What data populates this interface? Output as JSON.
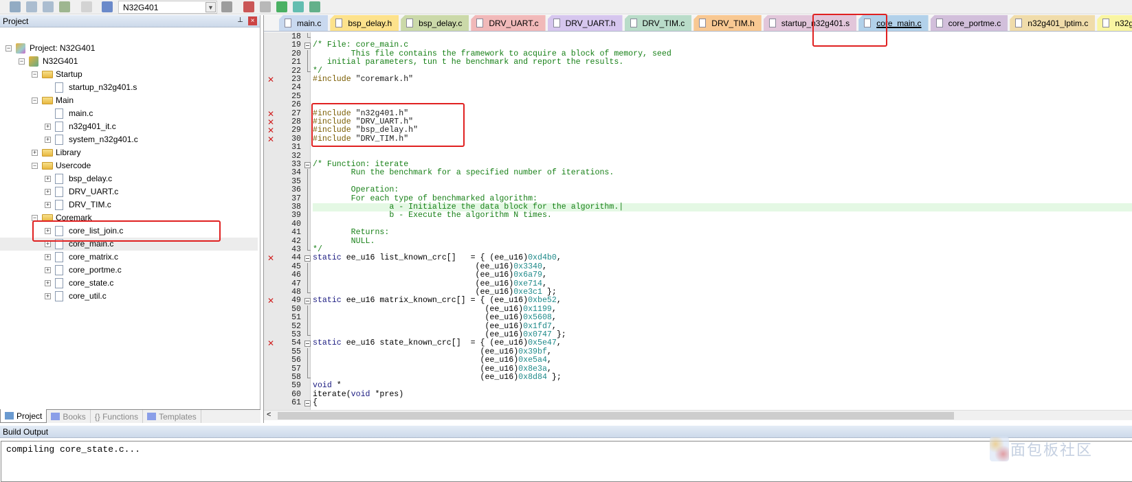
{
  "toolbar": {
    "target": "N32G401",
    "icons": [
      "batch-build-icon",
      "build-icon",
      "rebuild-icon",
      "stack-icon",
      "translate-icon",
      "load-icon",
      "options-icon",
      "manage-components-icon",
      "copy-icon",
      "pack-icon",
      "diamond-icon",
      "books-stack-icon"
    ]
  },
  "project_panel": {
    "title": "Project",
    "pin": "⊥",
    "close": "×"
  },
  "tree": [
    {
      "label": "Project: N32G401",
      "level": 0,
      "expander": "minus",
      "icon": "proj"
    },
    {
      "label": "N32G401",
      "level": 1,
      "expander": "minus",
      "icon": "target"
    },
    {
      "label": "Startup",
      "level": 2,
      "expander": "minus",
      "icon": "folder"
    },
    {
      "label": "startup_n32g401.s",
      "level": 3,
      "expander": "",
      "icon": "file"
    },
    {
      "label": "Main",
      "level": 2,
      "expander": "minus",
      "icon": "folder"
    },
    {
      "label": "main.c",
      "level": 3,
      "expander": "",
      "icon": "file"
    },
    {
      "label": "n32g401_it.c",
      "level": 3,
      "expander": "plus",
      "icon": "file"
    },
    {
      "label": "system_n32g401.c",
      "level": 3,
      "expander": "plus",
      "icon": "file"
    },
    {
      "label": "Library",
      "level": 2,
      "expander": "plus",
      "icon": "folder"
    },
    {
      "label": "Usercode",
      "level": 2,
      "expander": "minus",
      "icon": "folder"
    },
    {
      "label": "bsp_delay.c",
      "level": 3,
      "expander": "plus",
      "icon": "file"
    },
    {
      "label": "DRV_UART.c",
      "level": 3,
      "expander": "plus",
      "icon": "file"
    },
    {
      "label": "DRV_TIM.c",
      "level": 3,
      "expander": "plus",
      "icon": "file"
    },
    {
      "label": "Coremark",
      "level": 2,
      "expander": "minus",
      "icon": "folder"
    },
    {
      "label": "core_list_join.c",
      "level": 3,
      "expander": "plus",
      "icon": "file"
    },
    {
      "label": "core_main.c",
      "level": 3,
      "expander": "plus",
      "icon": "file",
      "selected": true
    },
    {
      "label": "core_matrix.c",
      "level": 3,
      "expander": "plus",
      "icon": "file"
    },
    {
      "label": "core_portme.c",
      "level": 3,
      "expander": "plus",
      "icon": "file"
    },
    {
      "label": "core_state.c",
      "level": 3,
      "expander": "plus",
      "icon": "file"
    },
    {
      "label": "core_util.c",
      "level": 3,
      "expander": "plus",
      "icon": "file"
    }
  ],
  "panel_tabs": [
    {
      "label": "Project",
      "active": true,
      "icon": "project-window-icon"
    },
    {
      "label": "Books",
      "icon": "books-icon"
    },
    {
      "label": "{} Functions",
      "icon": ""
    },
    {
      "label": "Templates",
      "icon": "templates-icon"
    }
  ],
  "editor_tabs": [
    {
      "label": "main.c",
      "color": "#c9d9ef"
    },
    {
      "label": "bsp_delay.h",
      "color": "#fde28c"
    },
    {
      "label": "bsp_delay.c",
      "color": "#cbd9a9"
    },
    {
      "label": "DRV_UART.c",
      "color": "#f1b9b9"
    },
    {
      "label": "DRV_UART.h",
      "color": "#d6c6ee"
    },
    {
      "label": "DRV_TIM.c",
      "color": "#b9dcc9"
    },
    {
      "label": "DRV_TIM.h",
      "color": "#f8c892"
    },
    {
      "label": "startup_n32g401.s",
      "color": "#e2c6da"
    },
    {
      "label": "core_main.c",
      "color": "#b2d1ea",
      "active": true
    },
    {
      "label": "core_portme.c",
      "color": "#d2bfdb"
    },
    {
      "label": "n32g401_lptim.c",
      "color": "#f0dcaa"
    },
    {
      "label": "n32g",
      "color": "#f9f5a2"
    }
  ],
  "code_lines": [
    {
      "n": "18",
      "fold": "end",
      "parts": []
    },
    {
      "n": "19",
      "fold": "open",
      "parts": [
        {
          "c": "cm",
          "t": "/* File: core_main.c"
        }
      ]
    },
    {
      "n": "20",
      "fold": "line",
      "parts": [
        {
          "c": "cm",
          "t": "        This file contains the framework to acquire a block of memory, seed"
        }
      ]
    },
    {
      "n": "21",
      "fold": "line",
      "parts": [
        {
          "c": "cm",
          "t": "   initial parameters, tun t he benchmark and report the results."
        }
      ]
    },
    {
      "n": "22",
      "fold": "end",
      "parts": [
        {
          "c": "cm",
          "t": "*/"
        }
      ]
    },
    {
      "n": "23",
      "err": true,
      "parts": [
        {
          "c": "pp",
          "t": "#include "
        },
        {
          "c": "str",
          "t": "\"coremark.h\""
        }
      ]
    },
    {
      "n": "24",
      "parts": []
    },
    {
      "n": "25",
      "parts": []
    },
    {
      "n": "26",
      "parts": []
    },
    {
      "n": "27",
      "err": true,
      "parts": [
        {
          "c": "pp",
          "t": "#include "
        },
        {
          "c": "str",
          "t": "\"n32g401.h\""
        }
      ]
    },
    {
      "n": "28",
      "err": true,
      "parts": [
        {
          "c": "pp",
          "t": "#include "
        },
        {
          "c": "str",
          "t": "\"DRV_UART.h\""
        }
      ]
    },
    {
      "n": "29",
      "err": true,
      "parts": [
        {
          "c": "pp",
          "t": "#include "
        },
        {
          "c": "str",
          "t": "\"bsp_delay.h\""
        }
      ]
    },
    {
      "n": "30",
      "err": true,
      "parts": [
        {
          "c": "pp",
          "t": "#include "
        },
        {
          "c": "str",
          "t": "\"DRV_TIM.h\""
        }
      ]
    },
    {
      "n": "31",
      "parts": []
    },
    {
      "n": "32",
      "parts": []
    },
    {
      "n": "33",
      "fold": "open",
      "parts": [
        {
          "c": "cm",
          "t": "/* Function: iterate"
        }
      ]
    },
    {
      "n": "34",
      "fold": "line",
      "parts": [
        {
          "c": "cm",
          "t": "        Run the benchmark for a specified number of iterations."
        }
      ]
    },
    {
      "n": "35",
      "fold": "line",
      "parts": []
    },
    {
      "n": "36",
      "fold": "line",
      "parts": [
        {
          "c": "cm",
          "t": "        Operation:"
        }
      ]
    },
    {
      "n": "37",
      "fold": "line",
      "parts": [
        {
          "c": "cm",
          "t": "        For each type of benchmarked algorithm:"
        }
      ]
    },
    {
      "n": "38",
      "fold": "line",
      "hl": true,
      "parts": [
        {
          "c": "cm",
          "t": "                a - Initialize the data block for the algorithm.|"
        }
      ]
    },
    {
      "n": "39",
      "fold": "line",
      "parts": [
        {
          "c": "cm",
          "t": "                b - Execute the algorithm N times."
        }
      ]
    },
    {
      "n": "40",
      "fold": "line",
      "parts": []
    },
    {
      "n": "41",
      "fold": "line",
      "parts": [
        {
          "c": "cm",
          "t": "        Returns:"
        }
      ]
    },
    {
      "n": "42",
      "fold": "line",
      "parts": [
        {
          "c": "cm",
          "t": "        NULL."
        }
      ]
    },
    {
      "n": "43",
      "fold": "end",
      "parts": [
        {
          "c": "cm",
          "t": "*/"
        }
      ]
    },
    {
      "n": "44",
      "err": true,
      "fold": "open",
      "parts": [
        {
          "c": "kw",
          "t": "static "
        },
        {
          "c": "pl",
          "t": "ee_u16 list_known_crc[]   = { (ee_u16)"
        },
        {
          "c": "num-lit",
          "t": "0xd4b0"
        },
        {
          "c": "pl",
          "t": ","
        }
      ]
    },
    {
      "n": "45",
      "fold": "line",
      "parts": [
        {
          "c": "pl",
          "t": "                                  (ee_u16)"
        },
        {
          "c": "num-lit",
          "t": "0x3340"
        },
        {
          "c": "pl",
          "t": ","
        }
      ]
    },
    {
      "n": "46",
      "fold": "line",
      "parts": [
        {
          "c": "pl",
          "t": "                                  (ee_u16)"
        },
        {
          "c": "num-lit",
          "t": "0x6a79"
        },
        {
          "c": "pl",
          "t": ","
        }
      ]
    },
    {
      "n": "47",
      "fold": "line",
      "parts": [
        {
          "c": "pl",
          "t": "                                  (ee_u16)"
        },
        {
          "c": "num-lit",
          "t": "0xe714"
        },
        {
          "c": "pl",
          "t": ","
        }
      ]
    },
    {
      "n": "48",
      "fold": "end",
      "parts": [
        {
          "c": "pl",
          "t": "                                  (ee_u16)"
        },
        {
          "c": "num-lit",
          "t": "0xe3c1"
        },
        {
          "c": "pl",
          "t": " };"
        }
      ]
    },
    {
      "n": "49",
      "err": true,
      "fold": "open",
      "parts": [
        {
          "c": "kw",
          "t": "static "
        },
        {
          "c": "pl",
          "t": "ee_u16 matrix_known_crc[] = { (ee_u16)"
        },
        {
          "c": "num-lit",
          "t": "0xbe52"
        },
        {
          "c": "pl",
          "t": ","
        }
      ]
    },
    {
      "n": "50",
      "fold": "line",
      "parts": [
        {
          "c": "pl",
          "t": "                                    (ee_u16)"
        },
        {
          "c": "num-lit",
          "t": "0x1199"
        },
        {
          "c": "pl",
          "t": ","
        }
      ]
    },
    {
      "n": "51",
      "fold": "line",
      "parts": [
        {
          "c": "pl",
          "t": "                                    (ee_u16)"
        },
        {
          "c": "num-lit",
          "t": "0x5608"
        },
        {
          "c": "pl",
          "t": ","
        }
      ]
    },
    {
      "n": "52",
      "fold": "line",
      "parts": [
        {
          "c": "pl",
          "t": "                                    (ee_u16)"
        },
        {
          "c": "num-lit",
          "t": "0x1fd7"
        },
        {
          "c": "pl",
          "t": ","
        }
      ]
    },
    {
      "n": "53",
      "fold": "end",
      "parts": [
        {
          "c": "pl",
          "t": "                                    (ee_u16)"
        },
        {
          "c": "num-lit",
          "t": "0x0747"
        },
        {
          "c": "pl",
          "t": " };"
        }
      ]
    },
    {
      "n": "54",
      "err": true,
      "fold": "open",
      "parts": [
        {
          "c": "kw",
          "t": "static "
        },
        {
          "c": "pl",
          "t": "ee_u16 state_known_crc[]  = { (ee_u16)"
        },
        {
          "c": "num-lit",
          "t": "0x5e47"
        },
        {
          "c": "pl",
          "t": ","
        }
      ]
    },
    {
      "n": "55",
      "fold": "line",
      "parts": [
        {
          "c": "pl",
          "t": "                                   (ee_u16)"
        },
        {
          "c": "num-lit",
          "t": "0x39bf"
        },
        {
          "c": "pl",
          "t": ","
        }
      ]
    },
    {
      "n": "56",
      "fold": "line",
      "parts": [
        {
          "c": "pl",
          "t": "                                   (ee_u16)"
        },
        {
          "c": "num-lit",
          "t": "0xe5a4"
        },
        {
          "c": "pl",
          "t": ","
        }
      ]
    },
    {
      "n": "57",
      "fold": "line",
      "parts": [
        {
          "c": "pl",
          "t": "                                   (ee_u16)"
        },
        {
          "c": "num-lit",
          "t": "0x8e3a"
        },
        {
          "c": "pl",
          "t": ","
        }
      ]
    },
    {
      "n": "58",
      "fold": "end",
      "parts": [
        {
          "c": "pl",
          "t": "                                   (ee_u16)"
        },
        {
          "c": "num-lit",
          "t": "0x8d84"
        },
        {
          "c": "pl",
          "t": " };"
        }
      ]
    },
    {
      "n": "59",
      "parts": [
        {
          "c": "kw",
          "t": "void "
        },
        {
          "c": "pl",
          "t": "*"
        }
      ]
    },
    {
      "n": "60",
      "parts": [
        {
          "c": "pl",
          "t": "iterate("
        },
        {
          "c": "kw",
          "t": "void "
        },
        {
          "c": "pl",
          "t": "*pres)"
        }
      ]
    },
    {
      "n": "61",
      "fold": "open",
      "parts": [
        {
          "c": "pl",
          "t": "{"
        }
      ]
    }
  ],
  "build_output": {
    "title": "Build Output",
    "text": "compiling core_state.c..."
  },
  "watermark": "面包板社区",
  "colors": {
    "error_mark": "#d02020",
    "annotation_box": "#e02020",
    "highlight_line": "#e4f8e4"
  }
}
